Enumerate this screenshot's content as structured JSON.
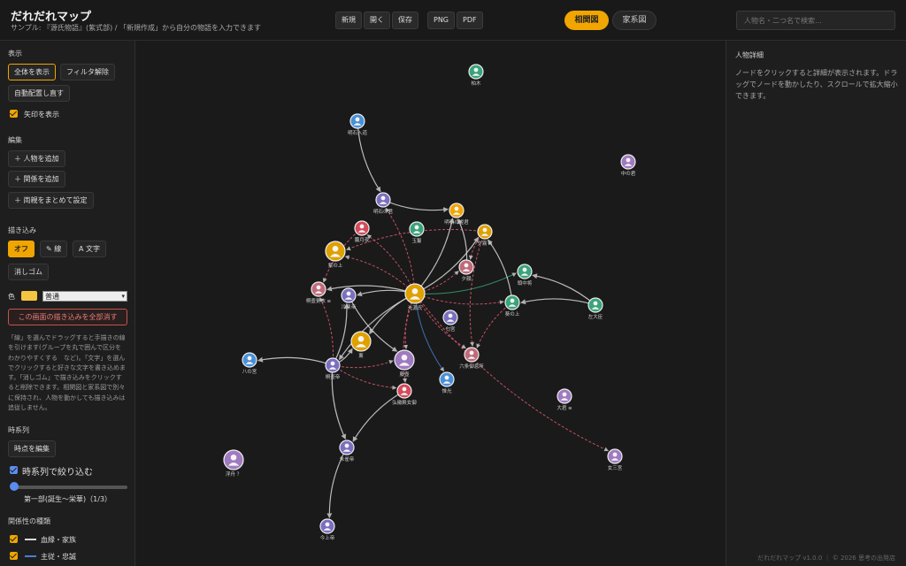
{
  "app": {
    "title": "だれだれマップ",
    "subtitle": "サンプル: 『源氏物語』(紫式部) / 「新規作成」から自分の物語を入力できます"
  },
  "toolbar": {
    "new_label": "新規",
    "open_label": "開く",
    "save_label": "保存",
    "png_label": "PNG",
    "pdf_label": "PDF"
  },
  "view_tabs": {
    "relation_label": "相関図",
    "family_label": "家系図",
    "active": "relation"
  },
  "search": {
    "placeholder": "人物名・二つ名で検索…"
  },
  "sidebar": {
    "display": {
      "title": "表示",
      "show_all": "全体を表示",
      "clear_filter": "フィルタ解除",
      "relayout": "自動配置し直す",
      "show_arrows": "矢印を表示",
      "show_arrows_checked": true
    },
    "edit": {
      "title": "編集",
      "add_person": "＋ 人物を追加",
      "add_relation": "＋ 関係を追加",
      "set_parents": "＋ 両親をまとめて設定"
    },
    "draw": {
      "title": "描き込み",
      "off": "オフ",
      "line": "✎ 線",
      "text": "A 文字",
      "eraser": "消しゴム",
      "color_label": "色",
      "color": "#f5c542",
      "style_value": "普通",
      "clear_all": "この画面の描き込みを全部消す",
      "help": "「線」を選んでドラッグすると手描きの線を引けます(グループを丸で囲んで区分をわかりやすくする　など)。「文字」を選んでクリックすると好きな文字を書き込めます。「消しゴム」で描き込みをクリックすると削除できます。相関図と家系図で別々に保持され、人物を動かしても描き込みは追従しません。"
    },
    "timeline": {
      "title": "時系列",
      "edit_points": "時点を編集",
      "filter_label": "時系列で絞り込む",
      "filter_checked": true,
      "slider_label": "第一部(誕生〜栄華)（1/3）",
      "slider_position": 1,
      "slider_count": 3
    },
    "relation_types": {
      "title": "関係性の種類",
      "items": [
        {
          "label": "血縁・家族",
          "color": "#d9d9d9",
          "checked": true
        },
        {
          "label": "主従・忠誠",
          "color": "#4a7fd0",
          "checked": true
        }
      ]
    }
  },
  "details": {
    "title": "人物詳細",
    "help": "ノードをクリックすると詳細が表示されます。ドラッグでノードを動かしたり、スクロールで拡大縮小できます。"
  },
  "footer": "だれだれマップ v1.0.0 ｜ © 2026 思考の出発店",
  "graph": {
    "colors": {
      "blood": "#d9d9d9",
      "loyalty": "#4a7fd0",
      "romance": "#e05a70",
      "ally": "#3aa37a"
    },
    "nodes": [
      {
        "id": "kashiwagi",
        "label": "柏木",
        "color": "#3aa37a"
      },
      {
        "id": "akashi_nyudo",
        "label": "明石入道",
        "color": "#4a90d9"
      },
      {
        "id": "naka_no_kimi",
        "label": "中の君",
        "color": "#a07ac0"
      },
      {
        "id": "akashi_no_kimi",
        "label": "明石の君",
        "color": "#7a6fc0"
      },
      {
        "id": "akashi_hime",
        "label": "明石の姫君",
        "color": "#f0a500"
      },
      {
        "id": "oborozukiyo",
        "label": "朧月夜",
        "color": "#d44a5a"
      },
      {
        "id": "tamakazura",
        "label": "玉鬘",
        "color": "#3aa37a"
      },
      {
        "id": "yugiri",
        "label": "夕霧",
        "color": "#e0a000"
      },
      {
        "id": "murasaki",
        "label": "紫の上",
        "color": "#e0a000"
      },
      {
        "id": "yugao",
        "label": "夕顔",
        "color": "#c06a7a"
      },
      {
        "id": "tonochujo",
        "label": "頭中将",
        "color": "#3aa37a"
      },
      {
        "id": "kokiden",
        "label": "桐壺更衣",
        "color": "#c06a7a"
      },
      {
        "id": "reizei",
        "label": "冷泉帝",
        "color": "#7a6fc0"
      },
      {
        "id": "genji",
        "label": "光源氏",
        "color": "#e0a000"
      },
      {
        "id": "aoi",
        "label": "葵の上",
        "color": "#3aa37a"
      },
      {
        "id": "sadaijin",
        "label": "左大臣",
        "color": "#3aa37a"
      },
      {
        "id": "kaoru",
        "label": "薫",
        "color": "#e0a000"
      },
      {
        "id": "niou",
        "label": "匂宮",
        "color": "#7a6fc0"
      },
      {
        "id": "hachi_no_miya",
        "label": "八の宮",
        "color": "#4a90d9"
      },
      {
        "id": "kiritsubo_tei",
        "label": "桐壺帝",
        "color": "#7a6fc0"
      },
      {
        "id": "fujitsubo",
        "label": "藤壺",
        "color": "#a07ac0"
      },
      {
        "id": "rokujo",
        "label": "六条御息所",
        "color": "#c06a7a"
      },
      {
        "id": "koremitsu",
        "label": "惟光",
        "color": "#4a90d9"
      },
      {
        "id": "kokiden_nyogo",
        "label": "弘徽殿女御",
        "color": "#d44a5a"
      },
      {
        "id": "oigimi",
        "label": "大君",
        "color": "#a07ac0"
      },
      {
        "id": "suzaku",
        "label": "朱雀帝",
        "color": "#7a6fc0"
      },
      {
        "id": "ukifune",
        "label": "浮舟",
        "color": "#a07ac0"
      },
      {
        "id": "onna_san",
        "label": "女三宮",
        "color": "#a07ac0"
      },
      {
        "id": "kinjo",
        "label": "今上帝",
        "color": "#7a6fc0"
      }
    ],
    "edges": [
      {
        "from": "akashi_nyudo",
        "to": "akashi_no_kimi",
        "type": "blood"
      },
      {
        "from": "akashi_no_kimi",
        "to": "akashi_hime",
        "type": "blood"
      },
      {
        "from": "genji",
        "to": "akashi_hime",
        "type": "blood"
      },
      {
        "from": "genji",
        "to": "akashi_no_kimi",
        "type": "romance"
      },
      {
        "from": "genji",
        "to": "oborozukiyo",
        "type": "romance"
      },
      {
        "from": "genji",
        "to": "murasaki",
        "type": "romance"
      },
      {
        "from": "genji",
        "to": "yugiri",
        "type": "blood"
      },
      {
        "from": "genji",
        "to": "aoi",
        "type": "romance"
      },
      {
        "from": "genji",
        "to": "yugao",
        "type": "romance"
      },
      {
        "from": "genji",
        "to": "reizei",
        "type": "blood"
      },
      {
        "from": "genji",
        "to": "kokiden",
        "type": "blood"
      },
      {
        "from": "genji",
        "to": "kaoru",
        "type": "blood"
      },
      {
        "from": "genji",
        "to": "kiritsubo_tei",
        "type": "blood"
      },
      {
        "from": "genji",
        "to": "fujitsubo",
        "type": "romance"
      },
      {
        "from": "genji",
        "to": "rokujo",
        "type": "romance"
      },
      {
        "from": "genji",
        "to": "koremitsu",
        "type": "loyalty"
      },
      {
        "from": "genji",
        "to": "tonochujo",
        "type": "ally"
      },
      {
        "from": "genji",
        "to": "kokiden_nyogo",
        "type": "romance"
      },
      {
        "from": "genji",
        "to": "onna_san",
        "type": "romance"
      },
      {
        "from": "yugiri",
        "to": "yugao",
        "type": "romance"
      },
      {
        "from": "yugiri",
        "to": "rokujo",
        "type": "romance"
      },
      {
        "from": "yugiri",
        "to": "murasaki",
        "type": "romance"
      },
      {
        "from": "aoi",
        "to": "yugiri",
        "type": "blood"
      },
      {
        "from": "aoi",
        "to": "rokujo",
        "type": "romance"
      },
      {
        "from": "kashiwagi",
        "to": "kashiwagi",
        "type": "blood"
      },
      {
        "from": "sadaijin",
        "to": "aoi",
        "type": "blood"
      },
      {
        "from": "sadaijin",
        "to": "tonochujo",
        "type": "blood"
      },
      {
        "from": "yugao",
        "to": "akashi_hime",
        "type": "blood"
      },
      {
        "from": "kiritsubo_tei",
        "to": "hachi_no_miya",
        "type": "blood"
      },
      {
        "from": "kiritsubo_tei",
        "to": "suzaku",
        "type": "blood"
      },
      {
        "from": "kiritsubo_tei",
        "to": "reizei",
        "type": "blood"
      },
      {
        "from": "kiritsubo_tei",
        "to": "fujitsubo",
        "type": "romance"
      },
      {
        "from": "kiritsubo_tei",
        "to": "kokiden_nyogo",
        "type": "romance"
      },
      {
        "from": "kiritsubo_tei",
        "to": "kokiden",
        "type": "romance"
      },
      {
        "from": "kiritsubo_tei",
        "to": "kaoru",
        "type": "blood"
      },
      {
        "from": "kokiden_nyogo",
        "to": "suzaku",
        "type": "blood"
      },
      {
        "from": "suzaku",
        "to": "kinjo",
        "type": "blood"
      },
      {
        "from": "oborozukiyo",
        "to": "kokiden",
        "type": "romance"
      },
      {
        "from": "reizei",
        "to": "fujitsubo",
        "type": "blood"
      }
    ]
  }
}
